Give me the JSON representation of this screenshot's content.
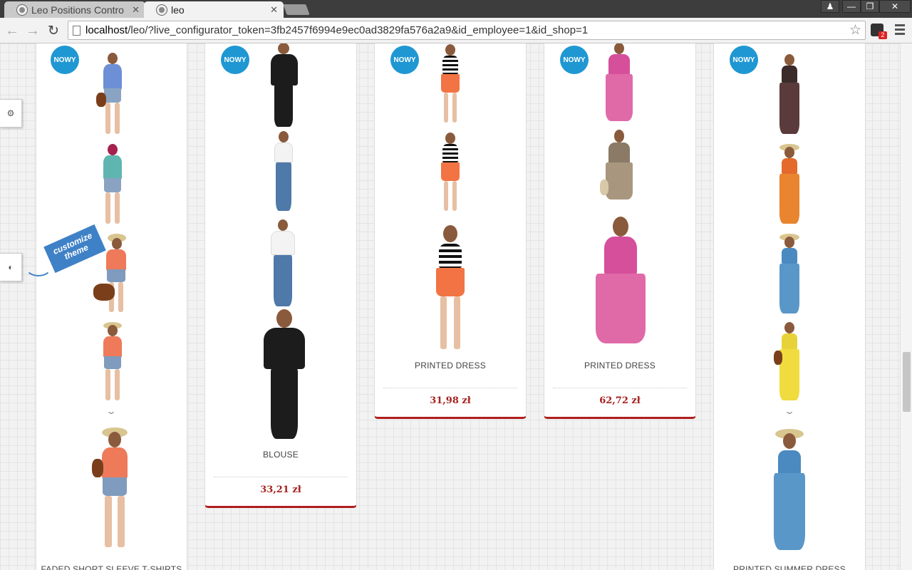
{
  "browser": {
    "tabs": [
      {
        "title": "Leo Positions Contro",
        "active": false
      },
      {
        "title": "leo",
        "active": true
      }
    ],
    "url_host": "localhost",
    "url_rest": "/leo/?live_configurator_token=3fb2457f6994e9ec0ad3829fa576a2a9&id_employee=1&id_shop=1",
    "extension_badge": "2"
  },
  "colors": {
    "badge_blue": "#1f97d2",
    "price_red": "#a5221e",
    "card_border_red": "#b01e1e",
    "customize_blue": "#3f81c7"
  },
  "icons": {
    "back": "arrow-left-icon",
    "forward": "arrow-right-icon",
    "reload": "reload-icon",
    "bookmark": "star-icon",
    "settings_tool": "gears-icon",
    "theme_tool": "contrast-icon"
  },
  "customize_label": {
    "line1": "customize",
    "line2": "theme"
  },
  "products": [
    {
      "badge": "NOWY",
      "name": "FADED SHORT SLEEVE T-SHIRTS",
      "price": ""
    },
    {
      "badge": "NOWY",
      "name": "BLOUSE",
      "price": "33,21 zł"
    },
    {
      "badge": "NOWY",
      "name": "PRINTED DRESS",
      "price": "31,98 zł"
    },
    {
      "badge": "NOWY",
      "name": "PRINTED DRESS",
      "price": "62,72 zł"
    },
    {
      "badge": "NOWY",
      "name": "PRINTED SUMMER DRESS",
      "price": ""
    }
  ]
}
